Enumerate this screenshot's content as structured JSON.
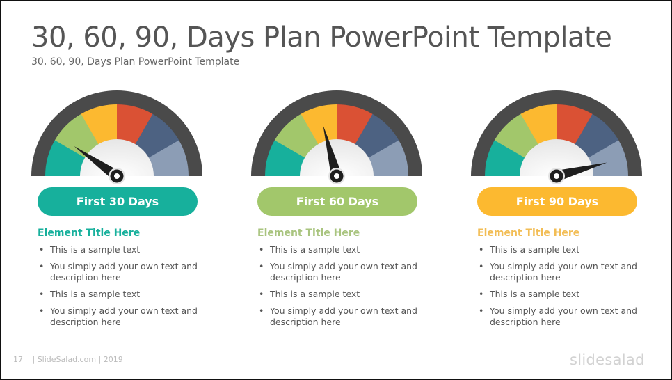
{
  "slide": {
    "title": "30, 60, 90, Days Plan PowerPoint Template",
    "subtitle": "30, 60, 90, Days Plan PowerPoint Template"
  },
  "gauge_segment_colors": [
    "#17b09c",
    "#a2c76b",
    "#fcb930",
    "#da5134",
    "#4d6282",
    "#8c9db5"
  ],
  "gauge_rim_color": "#4a4a4a",
  "columns": [
    {
      "label": "First 30 Days",
      "accent": "#17b09c",
      "needle_value_deg": 35,
      "element_title": "Element Title Here",
      "title_color": "#17b09c",
      "bullets": [
        "This is a sample text",
        "You simply add your own text and description here",
        "This is a sample text",
        "You simply add your own text and description here"
      ]
    },
    {
      "label": "First 60 Days",
      "accent": "#a2c76b",
      "needle_value_deg": 75,
      "element_title": "Element Title Here",
      "title_color": "#a9c47f",
      "bullets": [
        "This is a sample text",
        "You simply add your own text and description here",
        "This is a sample text",
        "You simply add your own text and description here"
      ]
    },
    {
      "label": "First 90 Days",
      "accent": "#fcb930",
      "needle_value_deg": 165,
      "element_title": "Element Title Here",
      "title_color": "#f2bd55",
      "bullets": [
        "This is a sample text",
        "You simply add your own text and description here",
        "This is a sample text",
        "You simply add your own text and description here"
      ]
    }
  ],
  "footer": {
    "page_number": "17",
    "text": "| SlideSalad.com | 2019",
    "brand": "slidesalad"
  }
}
